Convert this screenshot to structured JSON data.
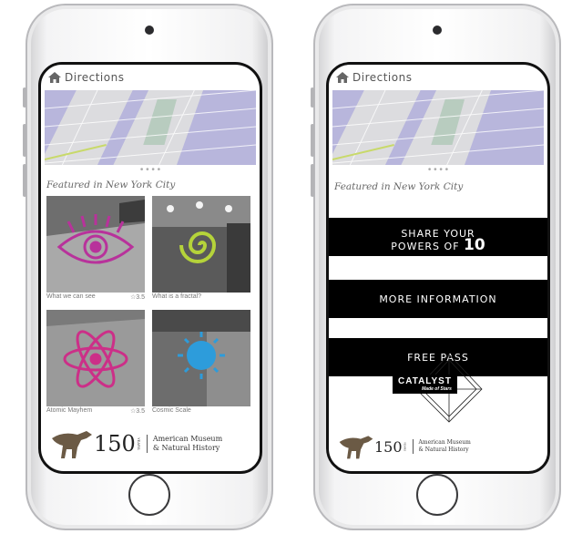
{
  "colors": {
    "screen_border": "#111111",
    "cta_bg": "#000000",
    "cta_text": "#ffffff",
    "map_water": "#b8b6dc",
    "map_park": "#b8ccbf"
  },
  "left_screen": {
    "header": {
      "title": "Directions",
      "icon": "home-icon"
    },
    "pager_dots": "• • • •",
    "featured_heading": "Featured in New York City",
    "tiles": [
      {
        "caption": "What we can see",
        "rating": "☆3.5",
        "icon": "eye-icon"
      },
      {
        "caption": "What is a fractal?",
        "rating": "",
        "icon": "spiral-icon"
      },
      {
        "caption": "Atomic Mayhem",
        "rating": "☆3.5",
        "icon": "atom-icon"
      },
      {
        "caption": "Cosmic Scale",
        "rating": "",
        "icon": "sun-icon"
      }
    ],
    "footer": {
      "years": "150",
      "years_label": "YEARS",
      "museum_line1": "American Museum",
      "museum_line2": "& Natural History"
    }
  },
  "right_screen": {
    "header": {
      "title": "Directions",
      "icon": "home-icon"
    },
    "pager_dots": "• • • •",
    "featured_heading": "Featured in New York City",
    "buttons": {
      "share_line1": "SHARE YOUR",
      "share_line2_prefix": "POWERS OF",
      "share_line2_number": "10",
      "more_info": "MORE INFORMATION",
      "free_pass": "FREE PASS"
    },
    "catalyst": {
      "title": "CATALYST",
      "subtitle": "Made of Stars"
    },
    "footer": {
      "years": "150",
      "years_label": "YEARS",
      "museum_line1": "American Museum",
      "museum_line2": "& Natural History"
    }
  }
}
